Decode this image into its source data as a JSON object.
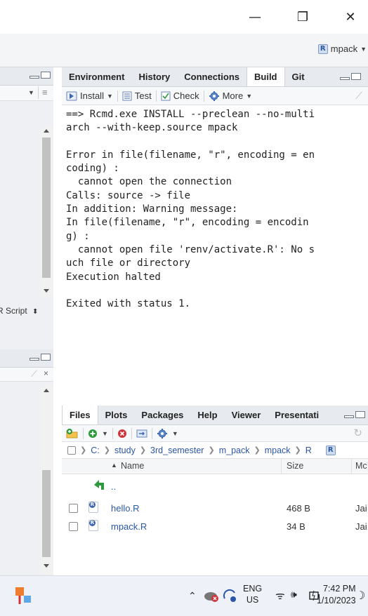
{
  "window": {
    "minimize_glyph": "—",
    "restore_glyph": "❐",
    "close_glyph": "✕"
  },
  "project": {
    "name": "mpack"
  },
  "left_pane": {
    "script_label": "R Script"
  },
  "top_pane": {
    "tabs": [
      {
        "label": "Environment"
      },
      {
        "label": "History"
      },
      {
        "label": "Connections"
      },
      {
        "label": "Build"
      },
      {
        "label": "Git"
      }
    ],
    "active_tab": "Build",
    "toolbar": {
      "install_label": "Install",
      "test_label": "Test",
      "check_label": "Check",
      "more_label": "More"
    },
    "console_lines": [
      "==> Rcmd.exe INSTALL --preclean --no-multi",
      "arch --with-keep.source mpack",
      "",
      "Error in file(filename, \"r\", encoding = en",
      "coding) :",
      "  cannot open the connection",
      "Calls: source -> file",
      "In addition: Warning message:",
      "In file(filename, \"r\", encoding = encodin",
      "g) :",
      "  cannot open file 'renv/activate.R': No s",
      "uch file or directory",
      "Execution halted",
      "",
      "Exited with status 1."
    ]
  },
  "bottom_pane": {
    "tabs": [
      {
        "label": "Files"
      },
      {
        "label": "Plots"
      },
      {
        "label": "Packages"
      },
      {
        "label": "Help"
      },
      {
        "label": "Viewer"
      },
      {
        "label": "Presentati"
      }
    ],
    "active_tab": "Files",
    "path": [
      "C:",
      "study",
      "3rd_semester",
      "m_pack",
      "mpack",
      "R"
    ],
    "columns": {
      "name": "Name",
      "size": "Size",
      "modified": "Mc"
    },
    "parent_dir": "..",
    "files": [
      {
        "name": "hello.R",
        "size": "468 B",
        "modified": "Jai"
      },
      {
        "name": "mpack.R",
        "size": "34 B",
        "modified": "Jai"
      }
    ]
  },
  "taskbar": {
    "language": "ENG",
    "region": "US",
    "time": "7:42 PM",
    "date": "1/10/2023"
  },
  "colors": {
    "link": "#2a56a8",
    "accent_green": "#2e9a3e",
    "error_red": "#d13438"
  }
}
